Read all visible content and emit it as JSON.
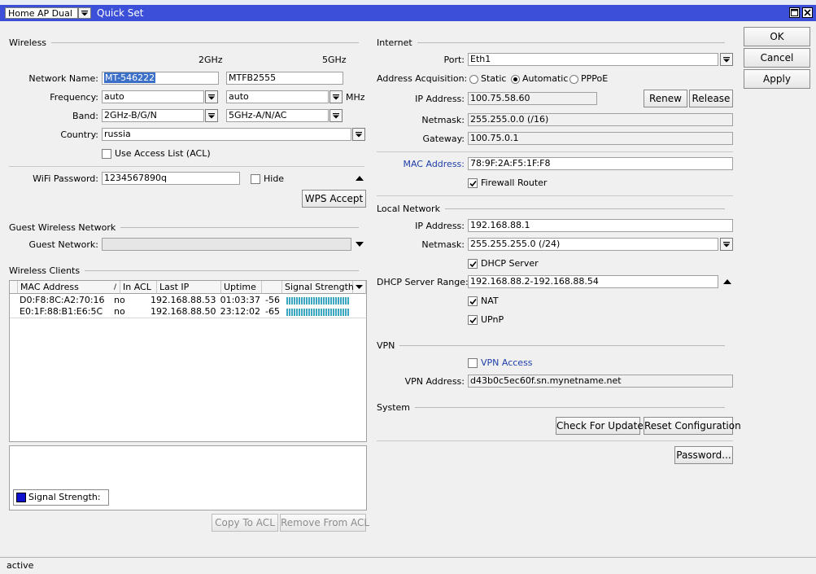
{
  "topstrip_text": "...",
  "titlebar": {
    "mode_value": "Home AP Dual",
    "title": "Quick Set"
  },
  "actions": {
    "ok": "OK",
    "cancel": "Cancel",
    "apply": "Apply"
  },
  "wireless": {
    "section": "Wireless",
    "col_2ghz": "2GHz",
    "col_5ghz": "5GHz",
    "network_name_label": "Network Name:",
    "network_name_2g": "MT-546222",
    "network_name_5g": "MTFB2555",
    "frequency_label": "Frequency:",
    "frequency_2g": "auto",
    "frequency_5g": "auto",
    "frequency_unit": "MHz",
    "band_label": "Band:",
    "band_2g": "2GHz-B/G/N",
    "band_5g": "5GHz-A/N/AC",
    "country_label": "Country:",
    "country": "russia",
    "acl_label": "Use Access List (ACL)",
    "wifi_password_label": "WiFi Password:",
    "wifi_password": "1234567890q",
    "hide_label": "Hide",
    "wps_button": "WPS Accept"
  },
  "guest": {
    "section": "Guest Wireless Network",
    "network_label": "Guest Network:",
    "network_value": ""
  },
  "clients": {
    "section": "Wireless Clients",
    "columns": [
      "MAC Address",
      "In ACL",
      "Last IP",
      "Uptime",
      "",
      "Signal Strength"
    ],
    "rows": [
      {
        "mac": "D0:F8:8C:A2:70:16",
        "in_acl": "no",
        "last_ip": "192.168.88.53",
        "uptime": "01:03:37",
        "signal": "-56"
      },
      {
        "mac": "E0:1F:88:B1:E6:5C",
        "in_acl": "no",
        "last_ip": "192.168.88.50",
        "uptime": "23:12:02",
        "signal": "-65"
      }
    ],
    "legend": "Signal Strength:",
    "legend_color": "#1010d0",
    "copy_acl": "Copy To ACL",
    "remove_acl": "Remove From ACL"
  },
  "internet": {
    "section": "Internet",
    "port_label": "Port:",
    "port": "Eth1",
    "acq_label": "Address Acquisition:",
    "acq_options": [
      "Static",
      "Automatic",
      "PPPoE"
    ],
    "acq_selected": "Automatic",
    "ip_label": "IP Address:",
    "ip": "100.75.58.60",
    "renew": "Renew",
    "release": "Release",
    "netmask_label": "Netmask:",
    "netmask": "255.255.0.0 (/16)",
    "gateway_label": "Gateway:",
    "gateway": "100.75.0.1",
    "mac_label": "MAC Address:",
    "mac": "78:9F:2A:F5:1F:F8",
    "firewall_label": "Firewall Router"
  },
  "local": {
    "section": "Local Network",
    "ip_label": "IP Address:",
    "ip": "192.168.88.1",
    "netmask_label": "Netmask:",
    "netmask": "255.255.255.0 (/24)",
    "dhcp_label": "DHCP Server",
    "range_label": "DHCP Server Range:",
    "range": "192.168.88.2-192.168.88.54",
    "nat_label": "NAT",
    "upnp_label": "UPnP"
  },
  "vpn": {
    "section": "VPN",
    "access_label": "VPN Access",
    "address_label": "VPN Address:",
    "address": "d43b0c5ec60f.sn.mynetname.net"
  },
  "system": {
    "section": "System",
    "check_updates": "Check For Updates",
    "reset_config": "Reset Configuration",
    "password": "Password..."
  },
  "status": "active",
  "colors": {
    "titlebar": "#3b4fd8",
    "selection": "#3b6fc8",
    "signal_bar": "#3aa6c0",
    "link_label": "#1e3ea8"
  }
}
